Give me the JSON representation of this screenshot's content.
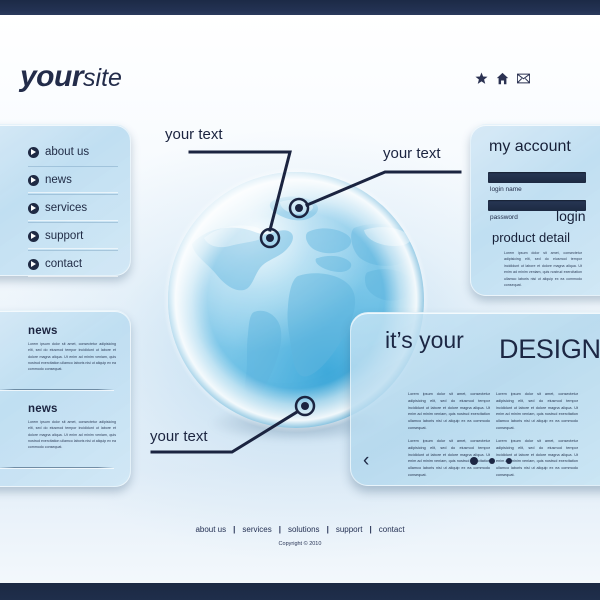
{
  "theme": {
    "navy": "#1d2b47",
    "accent_blue": "#6ebde4",
    "panel_blue": "#bddcf1",
    "text_dark": "#1b2440"
  },
  "header": {
    "logo_primary": "your",
    "logo_secondary": "site",
    "icons": [
      "star-icon",
      "home-icon",
      "mail-icon"
    ]
  },
  "nav": {
    "items": [
      {
        "label": "about us"
      },
      {
        "label": "news"
      },
      {
        "label": "services"
      },
      {
        "label": "support"
      },
      {
        "label": "contact"
      }
    ]
  },
  "news_panel": {
    "blocks": [
      {
        "title": "news",
        "text": "Lorem ipsum dolor sit amet, consectetur adipisicing elit, sed do eiusmod tempor incididunt ut labore et dolore magna aliqua. Ut enim ad minim veniam, quis nostrud exercitation ullamco laboris nisi ut aliquip ex ea commodo consequat."
      },
      {
        "title": "news",
        "text": "Lorem ipsum dolor sit amet, consectetur adipisicing elit, sed do eiusmod tempor incididunt ut labore et dolore magna aliqua. Ut enim ad minim veniam, quis nostrud exercitation ullamco laboris nisi ut aliquip ex ea commodo consequat."
      }
    ]
  },
  "account": {
    "title": "my account",
    "login_value": "",
    "login_placeholder": "",
    "login_label": "login name",
    "password_value": "",
    "password_placeholder": "",
    "password_label": "password",
    "login_button": "login",
    "product_detail_title": "product detail",
    "product_detail_text": "Lorem ipsum dolor sit amet, consectetur adipisicing elit, sed do eiusmod tempor incididunt ut labore et dolore magna aliqua. Ut enim ad minim veniam, quis nostrud exercitation ullamco laboris nisi ut aliquip ex ea commodo consequat."
  },
  "main": {
    "heading_light": "it’s your",
    "heading_bold": "DESIGN!",
    "column1": [
      "Lorem ipsum dolor sit amet, consectetur adipisicing elit, sed do eiusmod tempor incididunt ut labore et dolore magna aliqua. Ut enim ad minim veniam, quis nostrud exercitation ullamco laboris nisi ut aliquip ex ea commodo consequat.",
      "Lorem ipsum dolor sit amet, consectetur adipisicing elit, sed do eiusmod tempor incididunt ut labore et dolore magna aliqua. Ut enim ad minim veniam, quis nostrud exercitation ullamco laboris nisi ut aliquip ex ea commodo consequat."
    ],
    "column2": [
      "Lorem ipsum dolor sit amet, consectetur adipisicing elit, sed do eiusmod tempor incididunt ut labore et dolore magna aliqua. Ut enim ad minim veniam, quis nostrud exercitation ullamco laboris nisi ut aliquip ex ea commodo consequat.",
      "Lorem ipsum dolor sit amet, consectetur adipisicing elit, sed do eiusmod tempor incididunt ut labore et dolore magna aliqua. Ut enim ad minim veniam, quis nostrud exercitation ullamco laboris nisi ut aliquip ex ea commodo consequat."
    ],
    "carousel": {
      "prev": "‹",
      "next": "›",
      "slide_count": 3,
      "active_slide": 1
    }
  },
  "callouts": [
    {
      "label": "your text"
    },
    {
      "label": "your text"
    },
    {
      "label": "your text"
    }
  ],
  "footer": {
    "links": [
      "about us",
      "services",
      "solutions",
      "support",
      "contact"
    ],
    "separator": "|",
    "copyright": "Copyright © 2010"
  }
}
